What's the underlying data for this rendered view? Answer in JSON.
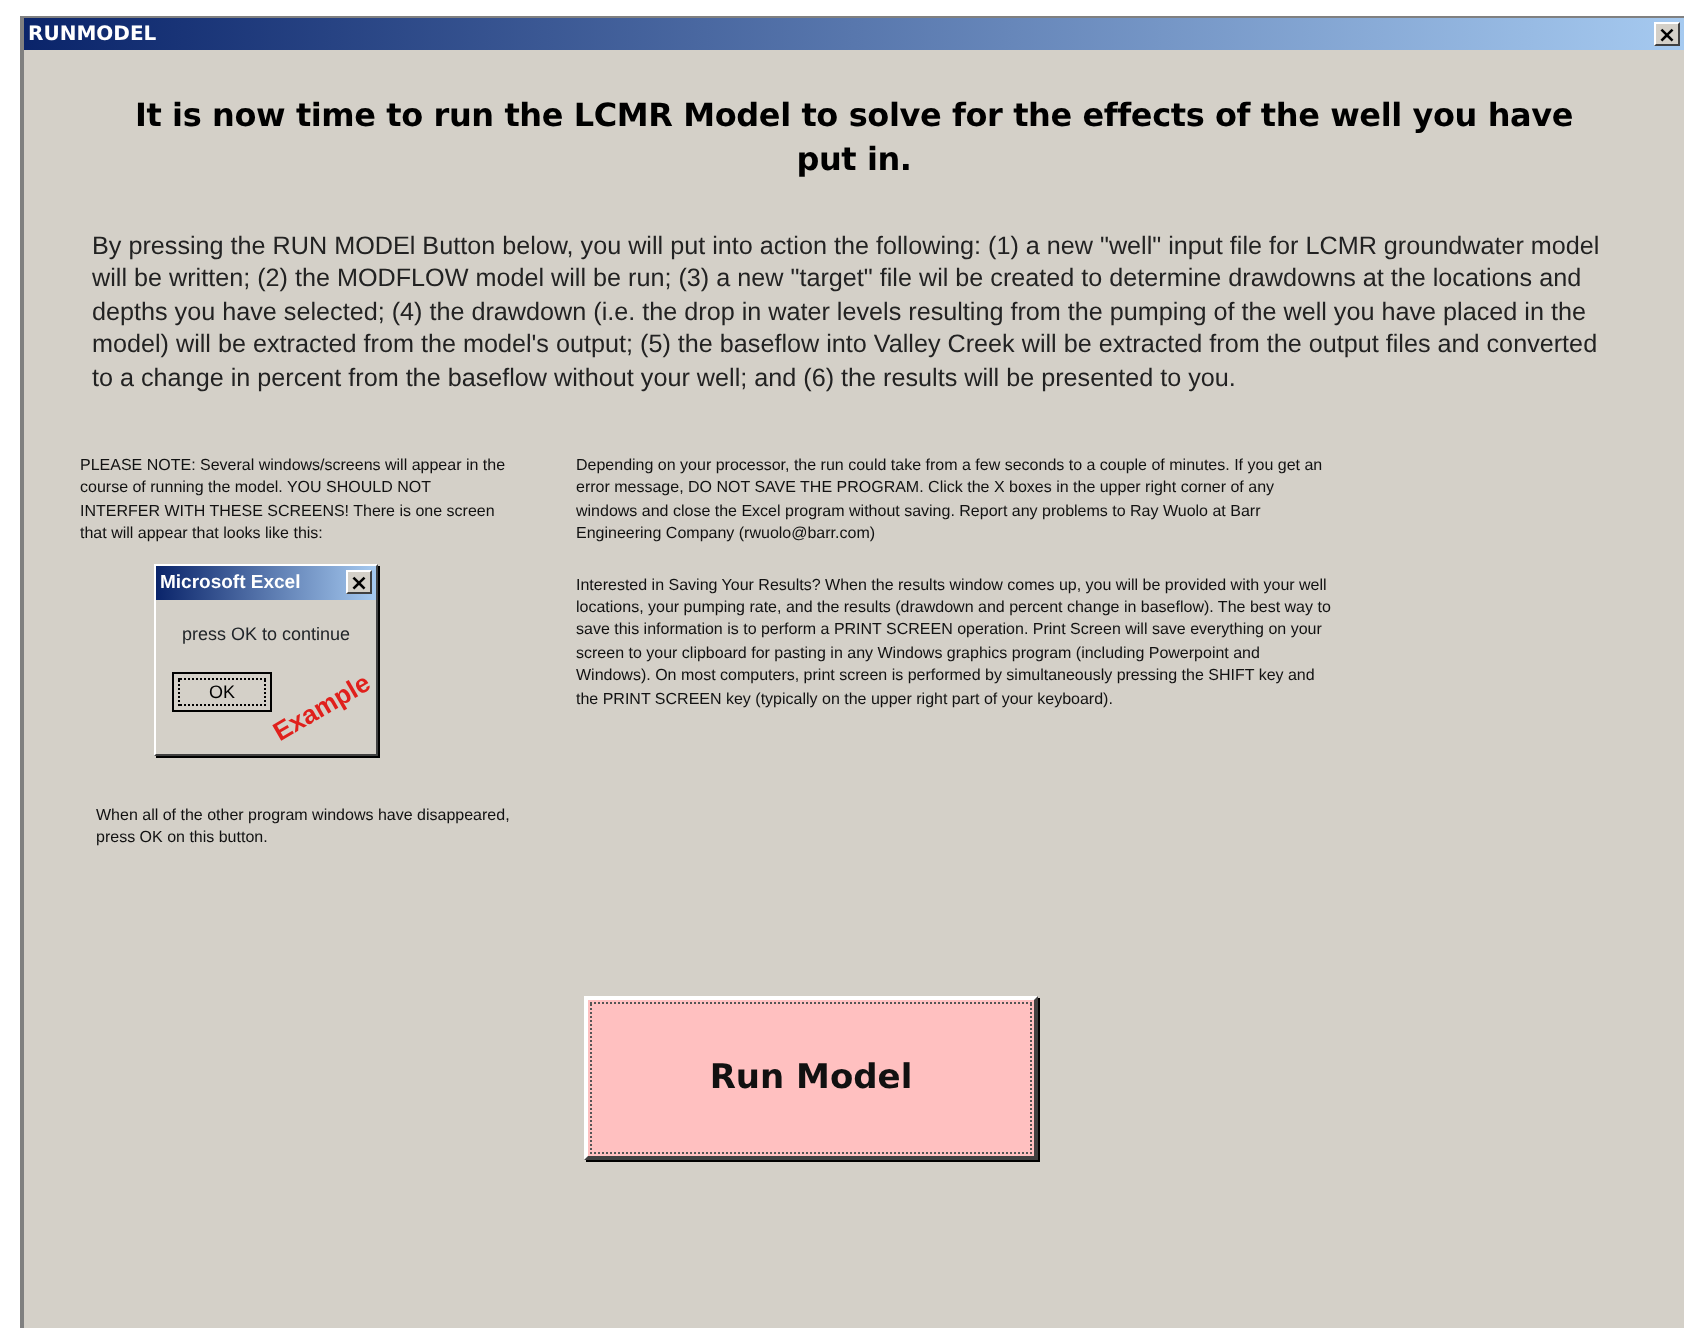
{
  "window": {
    "title": "RUNMODEL",
    "close": "×"
  },
  "heading": "It is now time to run the LCMR Model to solve for the effects of the well you have put in.",
  "intro": "By pressing the RUN MODEl Button below, you will put into action the following: (1) a new \"well\" input file for LCMR groundwater model will be written; (2) the MODFLOW model will be run; (3) a new \"target\" file wil be created to determine drawdowns at the locations and depths you have selected; (4) the drawdown (i.e. the drop in water levels resulting from the pumping of the well you have placed in the model) will be extracted from the model's output; (5) the baseflow into Valley Creek will be extracted from the output files and converted to a change in percent from the baseflow without your well; and (6) the results will be presented to you.",
  "note": "PLEASE NOTE: Several windows/screens will appear in the course of running the model. YOU SHOULD NOT INTERFER WITH THESE SCREENS! There is one screen that will appear that looks like this:",
  "example_dialog": {
    "title": "Microsoft Excel",
    "close": "×",
    "message": "press OK to continue",
    "button": "OK",
    "stamp": "Example"
  },
  "after_note": "When all of the other program windows have disappeared, press OK on this button.",
  "info": [
    "Depending on your processor, the run could take from a few seconds to a couple of minutes. If you get an error message, DO NOT SAVE THE PROGRAM. Click the X boxes in the upper right corner of any windows and close the Excel program without saving. Report any problems to Ray Wuolo at Barr Engineering Company (rwuolo@barr.com)",
    "Interested in Saving Your Results?  When the results window comes up, you will be provided with your well locations, your pumping rate, and the results (drawdown and percent change in baseflow). The best way to save this information is to perform a PRINT SCREEN operation. Print Screen will save everything on your screen to your clipboard for pasting in any Windows graphics program (including Powerpoint and Windows). On most computers, print screen is performed by simultaneously pressing the SHIFT key and the PRINT SCREEN key (typically on the upper right part of your keyboard)."
  ],
  "run_button": "Run Model"
}
